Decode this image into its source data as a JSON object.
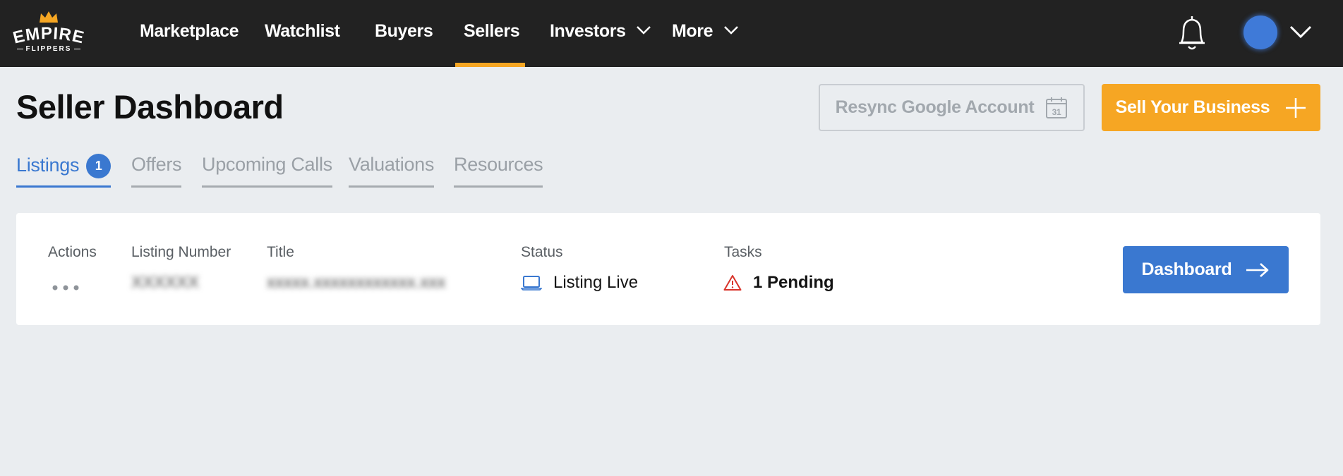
{
  "brand": {
    "name": "EMPIRE",
    "sub": "FLIPPERS",
    "accent": "#f5a623"
  },
  "nav": {
    "items": [
      {
        "label": "Marketplace"
      },
      {
        "label": "Watchlist"
      },
      {
        "label": "Buyers"
      },
      {
        "label": "Sellers",
        "active": true
      },
      {
        "label": "Investors",
        "dropdown": true
      },
      {
        "label": "More",
        "dropdown": true
      }
    ],
    "icons": [
      "bell-icon",
      "avatar",
      "chevron-down-icon"
    ]
  },
  "header": {
    "title": "Seller Dashboard",
    "resync_label": "Resync Google Account",
    "calendar_day": "31",
    "sell_label": "Sell Your Business"
  },
  "tabs": [
    {
      "label": "Listings",
      "badge": "1",
      "active": true
    },
    {
      "label": "Offers"
    },
    {
      "label": "Upcoming Calls"
    },
    {
      "label": "Valuations"
    },
    {
      "label": "Resources"
    }
  ],
  "listing": {
    "columns": {
      "actions": "Actions",
      "number": "Listing Number",
      "title": "Title",
      "status": "Status",
      "tasks": "Tasks"
    },
    "row": {
      "number": "XXXXXX",
      "title": "xxxxx.xxxxxxxxxxxx.xxx",
      "status": "Listing Live",
      "tasks": "1 Pending"
    },
    "dashboard_label": "Dashboard"
  },
  "colors": {
    "topbar": "#222222",
    "primary": "#3a78d0",
    "orange": "#f6a623",
    "warning": "#d9342b"
  }
}
